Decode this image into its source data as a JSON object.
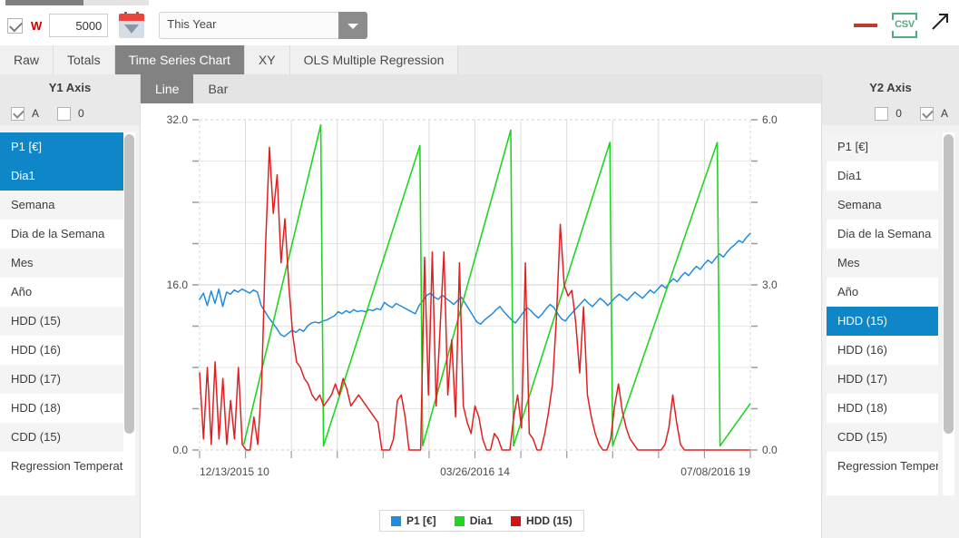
{
  "toolbar": {
    "checkbox_checked": true,
    "w_label": "W",
    "threshold_value": "5000",
    "threshold_placeholder": "",
    "calendar_icon": "calendar-icon",
    "period_select": "This Year",
    "minus_icon": "minus-icon",
    "csv_label": "CSV",
    "csv_icon": "csv-export-icon",
    "expand_icon": "expand-arrow-icon"
  },
  "main_tabs": [
    {
      "label": "Raw",
      "active": false
    },
    {
      "label": "Totals",
      "active": false
    },
    {
      "label": "Time Series Chart",
      "active": true
    },
    {
      "label": "XY",
      "active": false
    },
    {
      "label": "OLS Multiple Regression",
      "active": false
    }
  ],
  "chart_tabs": [
    {
      "label": "Line",
      "active": true
    },
    {
      "label": "Bar",
      "active": false
    }
  ],
  "y1_axis": {
    "title": "Y1 Axis",
    "checkbox_a": {
      "label": "A",
      "checked": true
    },
    "checkbox_0": {
      "label": "0",
      "checked": false
    },
    "items": [
      {
        "label": "P1 [€]",
        "selected": true
      },
      {
        "label": "Dia1",
        "selected": true
      },
      {
        "label": "Semana",
        "selected": false
      },
      {
        "label": "Dia de la Semana",
        "selected": false
      },
      {
        "label": "Mes",
        "selected": false
      },
      {
        "label": "Año",
        "selected": false
      },
      {
        "label": "HDD (15)",
        "selected": false
      },
      {
        "label": "HDD (16)",
        "selected": false
      },
      {
        "label": "HDD (17)",
        "selected": false
      },
      {
        "label": "HDD (18)",
        "selected": false
      },
      {
        "label": "CDD (15)",
        "selected": false
      },
      {
        "label": "Regression Temperature",
        "selected": false
      }
    ]
  },
  "y2_axis": {
    "title": "Y2 Axis",
    "checkbox_0": {
      "label": "0",
      "checked": false
    },
    "checkbox_a": {
      "label": "A",
      "checked": true
    },
    "items": [
      {
        "label": "P1 [€]",
        "selected": false
      },
      {
        "label": "Dia1",
        "selected": false
      },
      {
        "label": "Semana",
        "selected": false
      },
      {
        "label": "Dia de la Semana",
        "selected": false
      },
      {
        "label": "Mes",
        "selected": false
      },
      {
        "label": "Año",
        "selected": false
      },
      {
        "label": "HDD (15)",
        "selected": true
      },
      {
        "label": "HDD (16)",
        "selected": false
      },
      {
        "label": "HDD (17)",
        "selected": false
      },
      {
        "label": "HDD (18)",
        "selected": false
      },
      {
        "label": "CDD (15)",
        "selected": false
      },
      {
        "label": "Regression Temperature",
        "selected": false
      }
    ]
  },
  "chart_data": {
    "type": "line",
    "title": "",
    "xlabel": "",
    "ylabel": "",
    "grid": true,
    "legend_position": "bottom",
    "x_tick_labels": [
      "12/13/2015 10",
      "03/26/2016 14",
      "07/08/2016 19"
    ],
    "y1_axis_label": "",
    "y1_tick_labels": [
      "0.0",
      "16.0",
      "32.0"
    ],
    "y1_lim": [
      0,
      32
    ],
    "y2_axis_label": "",
    "y2_tick_labels": [
      "0.0",
      "3.0",
      "6.0"
    ],
    "y2_lim": [
      0,
      6
    ],
    "colors": {
      "P1": "#1f8ce0",
      "Dia1": "#22d422",
      "HDD": "#e02020"
    },
    "legend": [
      {
        "name": "P1 [€]",
        "color": "#1f8ce0",
        "axis": "y1"
      },
      {
        "name": "Dia1",
        "color": "#22d422",
        "axis": "y1"
      },
      {
        "name": "HDD (15)",
        "color": "#e02020",
        "axis": "y2"
      }
    ],
    "series": [
      {
        "name": "P1 [€]",
        "color": "#1f8ce0",
        "axis": "y1",
        "values": [
          14.6,
          15.2,
          14.0,
          15.4,
          14.2,
          15.6,
          13.9,
          15.3,
          15.1,
          15.5,
          15.3,
          15.6,
          15.4,
          15.2,
          15.5,
          15.3,
          14.0,
          13.4,
          12.8,
          12.3,
          11.8,
          11.2,
          11.0,
          11.3,
          11.6,
          11.4,
          11.7,
          11.5,
          12.0,
          12.3,
          12.4,
          12.3,
          12.5,
          12.6,
          12.8,
          13.0,
          13.4,
          13.2,
          13.5,
          13.3,
          13.6,
          13.4,
          13.5,
          13.4,
          13.6,
          13.5,
          13.7,
          13.6,
          14.3,
          14.0,
          13.8,
          14.2,
          14.0,
          13.8,
          13.6,
          13.4,
          13.2,
          14.0,
          14.5,
          15.0,
          15.2,
          14.8,
          14.6,
          15.0,
          14.7,
          14.4,
          14.1,
          14.5,
          14.8,
          14.2,
          13.6,
          13.0,
          12.4,
          12.2,
          12.6,
          12.9,
          13.2,
          13.6,
          13.9,
          13.4,
          13.0,
          12.6,
          12.3,
          12.8,
          13.3,
          13.8,
          13.5,
          13.1,
          12.8,
          13.2,
          13.7,
          14.1,
          13.8,
          13.2,
          12.7,
          12.5,
          13.0,
          13.4,
          13.8,
          14.2,
          14.6,
          14.2,
          13.9,
          14.3,
          14.7,
          14.4,
          14.0,
          14.4,
          14.8,
          15.1,
          14.8,
          14.5,
          14.9,
          15.3,
          15.0,
          14.7,
          15.1,
          15.5,
          15.2,
          15.6,
          16.0,
          15.7,
          16.2,
          16.6,
          16.3,
          16.8,
          17.2,
          16.9,
          17.4,
          17.8,
          17.5,
          18.0,
          18.4,
          18.1,
          18.6,
          19.0,
          18.7,
          19.2,
          19.6,
          19.9,
          20.3,
          20.1,
          20.6,
          21.0
        ]
      },
      {
        "name": "Dia1",
        "color": "#22d422",
        "axis": "y1",
        "comment": "Sawtooth ramps from near 0 to ~30 then reset",
        "segments": [
          {
            "x0": 0.08,
            "x1": 0.22,
            "y0": 0.5,
            "y1": 31.5
          },
          {
            "x0": 0.22,
            "x1": 0.225,
            "y0": 31.5,
            "y1": 0.4
          },
          {
            "x0": 0.225,
            "x1": 0.4,
            "y0": 0.4,
            "y1": 29.5
          },
          {
            "x0": 0.4,
            "x1": 0.405,
            "y0": 29.5,
            "y1": 0.4
          },
          {
            "x0": 0.405,
            "x1": 0.565,
            "y0": 0.4,
            "y1": 31.0
          },
          {
            "x0": 0.565,
            "x1": 0.57,
            "y0": 31.0,
            "y1": 0.4
          },
          {
            "x0": 0.57,
            "x1": 0.745,
            "y0": 0.4,
            "y1": 29.8
          },
          {
            "x0": 0.745,
            "x1": 0.75,
            "y0": 29.8,
            "y1": 0.4
          },
          {
            "x0": 0.75,
            "x1": 0.94,
            "y0": 0.4,
            "y1": 29.8
          },
          {
            "x0": 0.94,
            "x1": 0.945,
            "y0": 29.8,
            "y1": 0.4
          },
          {
            "x0": 0.945,
            "x1": 1.0,
            "y0": 0.4,
            "y1": 4.5
          }
        ]
      },
      {
        "name": "HDD (15)",
        "color": "#e02020",
        "axis": "y2",
        "values": [
          1.4,
          0.2,
          1.5,
          0.1,
          1.6,
          0.2,
          1.3,
          0.1,
          0.9,
          0.2,
          1.5,
          0.1,
          0.0,
          0.0,
          0.6,
          0.1,
          1.2,
          3.7,
          5.5,
          4.3,
          5.0,
          3.4,
          4.2,
          3.0,
          2.1,
          1.6,
          1.5,
          1.3,
          1.2,
          1.0,
          0.9,
          1.0,
          0.8,
          0.9,
          1.0,
          1.2,
          1.0,
          1.3,
          1.1,
          0.8,
          0.9,
          1.0,
          0.9,
          0.8,
          0.7,
          0.6,
          0.5,
          0.0,
          0.0,
          0.0,
          0.2,
          0.9,
          1.0,
          0.6,
          0.0,
          0.0,
          0.0,
          0.0,
          3.5,
          1.0,
          3.6,
          0.8,
          2.2,
          3.6,
          1.0,
          2.0,
          0.6,
          3.4,
          0.8,
          0.5,
          0.3,
          0.8,
          0.6,
          0.2,
          0.0,
          0.0,
          0.3,
          0.2,
          0.0,
          0.0,
          0.0,
          0.6,
          1.0,
          0.4,
          3.4,
          0.3,
          0.2,
          0.0,
          0.0,
          0.3,
          0.7,
          1.2,
          2.4,
          4.1,
          3.0,
          2.8,
          2.9,
          2.3,
          1.4,
          2.6,
          1.0,
          0.6,
          0.3,
          0.1,
          0.0,
          0.0,
          0.2,
          0.8,
          1.2,
          0.7,
          0.4,
          0.2,
          0.1,
          0.0,
          0.0,
          0.0,
          0.0,
          0.0,
          0.0,
          0.0,
          0.1,
          0.4,
          1.0,
          0.5,
          0.1,
          0.0,
          0.0,
          0.0,
          0.0,
          0.0,
          0.0,
          0.0,
          0.0,
          0.0,
          0.0,
          0.0,
          0.0,
          0.0,
          0.0,
          0.0,
          0.0,
          0.0,
          0.0
        ]
      }
    ]
  }
}
